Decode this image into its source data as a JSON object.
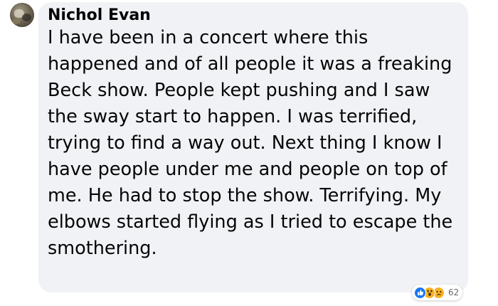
{
  "comment": {
    "author": "Nichol Evan",
    "text": "I have been in a concert where this happened and of all people it was a freaking Beck show. People kept pushing and I saw the sway start to happen. I was terrified, trying to find a way out. Next thing I know I have people under me and people on top of me. He had to stop the show. Terrifying. My elbows started flying as I tried to escape the smothering.",
    "reactions": {
      "icons": [
        "like-icon",
        "wow-icon",
        "sad-icon"
      ],
      "count": "62"
    }
  },
  "colors": {
    "bubble_background": "#f0f2f5",
    "text": "#050505",
    "like_blue": "#1877f2",
    "emoji_yellow": "#f7b125",
    "muted": "#65676b"
  }
}
